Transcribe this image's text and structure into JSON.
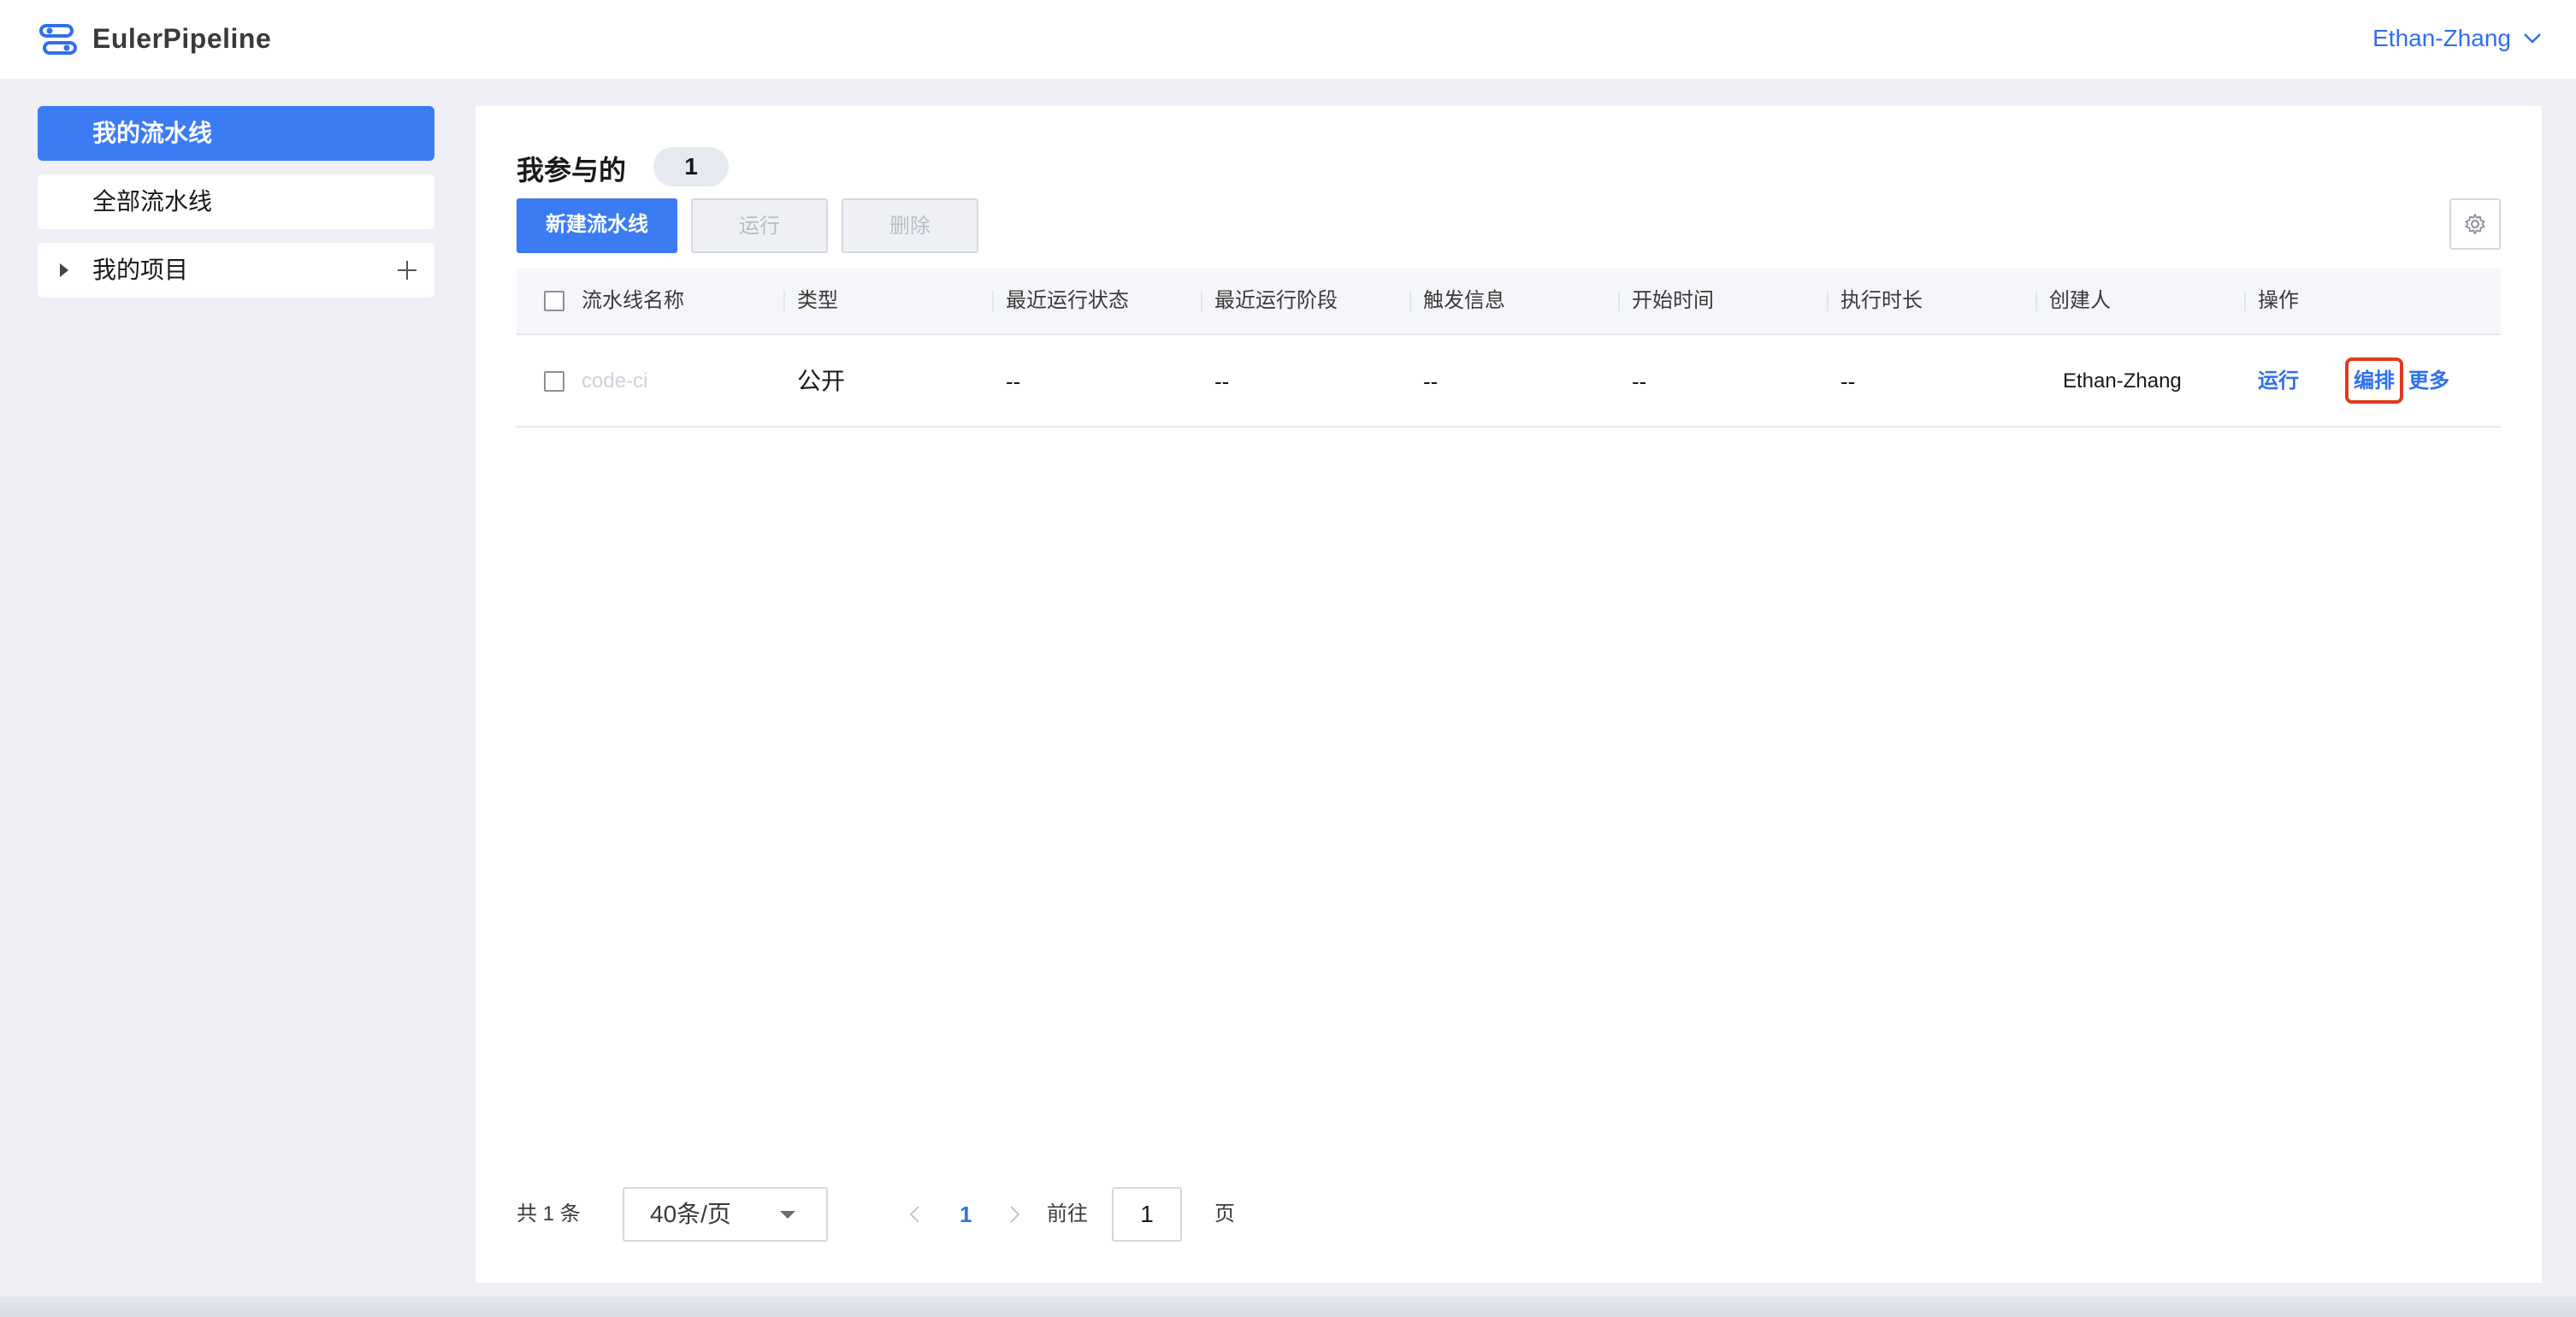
{
  "header": {
    "brand": "EulerPipeline",
    "user_name": "Ethan-Zhang"
  },
  "sidebar": {
    "items": [
      {
        "label": "我的流水线",
        "active": true
      },
      {
        "label": "全部流水线",
        "active": false
      },
      {
        "label": "我的项目",
        "active": false
      }
    ]
  },
  "main": {
    "title": "我参与的",
    "count": "1",
    "toolbar": {
      "new_label": "新建流水线",
      "run_label": "运行",
      "delete_label": "删除"
    }
  },
  "table": {
    "columns": [
      "流水线名称",
      "类型",
      "最近运行状态",
      "最近运行阶段",
      "触发信息",
      "开始时间",
      "执行时长",
      "创建人",
      "操作"
    ],
    "rows": [
      {
        "name": "code-ci",
        "type": "公开",
        "last_status": "--",
        "last_stage": "--",
        "trigger": "--",
        "start_time": "--",
        "duration": "--",
        "creator": "Ethan-Zhang",
        "actions": {
          "run": "运行",
          "edit": "编排",
          "more": "更多"
        }
      }
    ]
  },
  "pagination": {
    "total_label": "共 1 条",
    "page_size": "40条/页",
    "current_page": "1",
    "goto_label": "前往",
    "goto_value": "1",
    "page_label": "页"
  },
  "colors": {
    "accent": "#3b7cf5",
    "link": "#2f6ff0",
    "highlight_border": "#e03a1e"
  }
}
